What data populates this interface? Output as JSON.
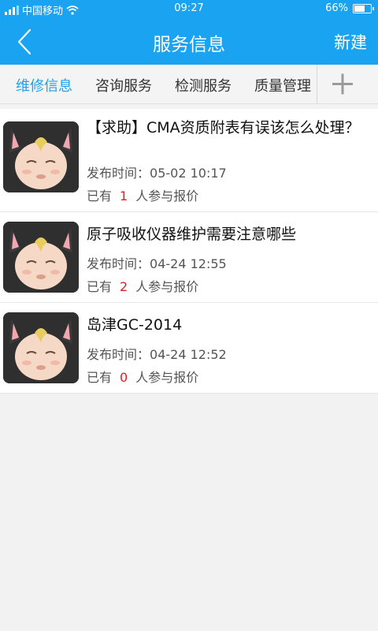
{
  "status_bar": {
    "carrier": "中国移动",
    "time": "09:27",
    "battery": "66%",
    "battery_level": 0.66
  },
  "header": {
    "back_icon": "chevron-left-icon",
    "title": "服务信息",
    "new_label": "新建"
  },
  "tabs": [
    {
      "label": "维修信息",
      "active": true
    },
    {
      "label": "咨询服务",
      "active": false
    },
    {
      "label": "检测服务",
      "active": false
    },
    {
      "label": "质量管理",
      "active": false
    }
  ],
  "add_tab_icon": "plus-icon",
  "posts": [
    {
      "title": "【求助】CMA资质附表有误该怎么处理？",
      "date_label": "发布时间：",
      "date": "05-02 10:17",
      "prefix": "已有",
      "count": "1",
      "suffix": "人参与报价"
    },
    {
      "title": "原子吸收仪器维护需要注意哪些",
      "date_label": "发布时间：",
      "date": "04-24 12:55",
      "prefix": "已有",
      "count": "2",
      "suffix": "人参与报价"
    },
    {
      "title": "岛津GC-2014",
      "date_label": "发布时间：",
      "date": "04-24 12:52",
      "prefix": "已有",
      "count": "0",
      "suffix": "人参与报价"
    }
  ],
  "colors": {
    "accent": "#1aa3f0",
    "count": "#e02020"
  }
}
